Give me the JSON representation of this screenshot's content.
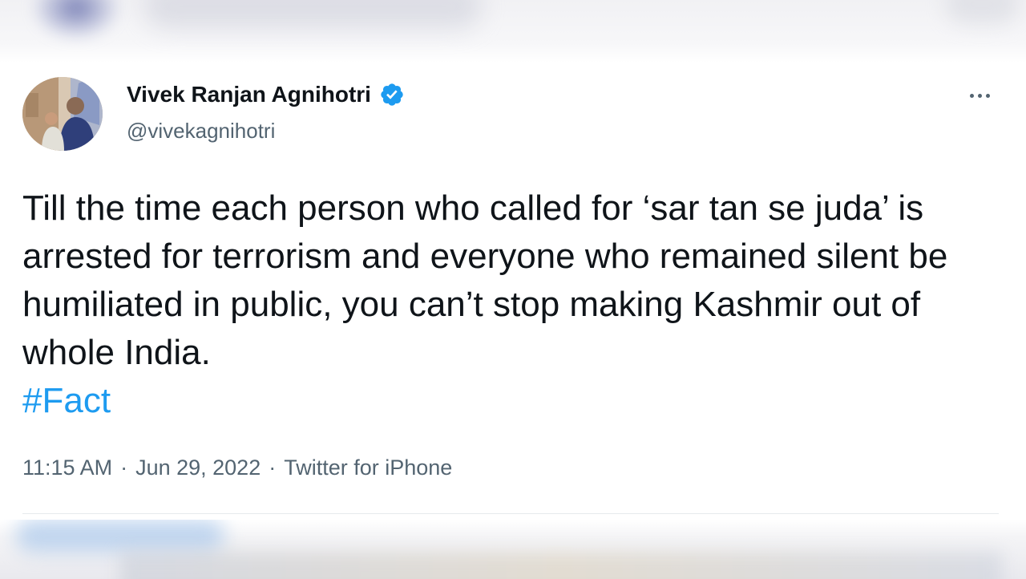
{
  "tweet": {
    "author_name": "Vivek Ranjan Agnihotri",
    "author_handle": "@vivekagnihotri",
    "verified": true,
    "text": "Till the time each person who called for ‘sar tan se juda’ is arrested for terrorism and everyone who remained silent be humiliated in public, you can’t stop making Kashmir out of whole India.",
    "hashtag": "#Fact",
    "time": "11:15 AM",
    "date": "Jun 29, 2022",
    "source": "Twitter for iPhone",
    "separator": "·"
  },
  "colors": {
    "text": "#0f1419",
    "secondary": "#536471",
    "accent": "#1d9bf0"
  },
  "icons": {
    "verified": "verified-badge-icon",
    "more": "more-options-icon"
  }
}
